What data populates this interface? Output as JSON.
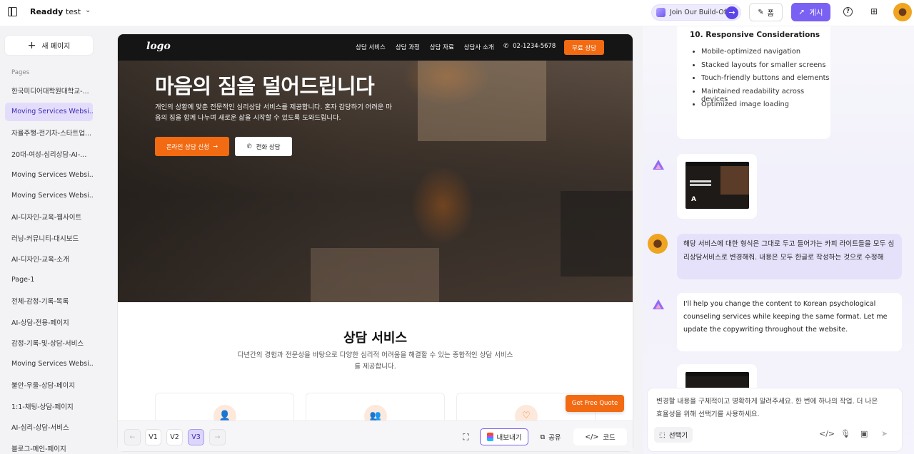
{
  "topbar": {
    "brand": "Readdy",
    "project": "test",
    "buildoff_label": "Join Our Build-Off",
    "form_label": "폼",
    "publish_label": "게시"
  },
  "sidebar": {
    "new_page_label": "새 페이지",
    "pages_heading": "Pages",
    "pages": [
      "한국미디어대학원대학교-...",
      "Moving Services Websi...",
      "자율주행-전기차-스타트업...",
      "20대-여성-심리상담-AI-...",
      "Moving Services Websi...",
      "Moving Services Websi...",
      "AI-디자인-교육-웹사이트",
      "러닝-커뮤니티-대시보드",
      "AI-디자인-교육-소개",
      "Page-1",
      "전체-감정-기록-목록",
      "AI-상담-전용-페이지",
      "감정-기록-및-상담-서비스",
      "Moving Services Websi...",
      "불안-우울-상담-페이지",
      "1:1-채팅-상담-페이지",
      "AI-심리-상담-서비스",
      "블로그-메인-페이지"
    ]
  },
  "preview": {
    "logo": "logo",
    "nav_links": [
      "상담 서비스",
      "상담 과정",
      "상담 자료",
      "상담사 소개"
    ],
    "phone": "02-1234-5678",
    "nav_cta": "무료 상담",
    "hero_title": "마음의 짐을 덜어드립니다",
    "hero_sub": "개인의 상황에 맞춘 전문적인 심리상담 서비스를 제공합니다. 혼자 감당하기 어려운 마음의 짐을 함께 나누며 새로운 삶을 시작할 수 있도록 도와드립니다.",
    "hero_btn_primary": "온라인 상담 신청",
    "hero_btn_secondary": "전화 상담",
    "services_title": "상담 서비스",
    "services_sub": "다년간의 경험과 전문성을 바탕으로 다양한 심리적 어려움을 해결할 수 있는 종합적인 상담 서비스를 제공합니다.",
    "quote_btn": "Get Free Quote"
  },
  "preview_toolbar": {
    "versions": [
      "V1",
      "V2",
      "V3"
    ],
    "active_version": "V3",
    "export_label": "내보내기",
    "share_label": "공유",
    "code_label": "코드"
  },
  "chat": {
    "doc_heading": "10. Responsive Considerations",
    "doc_items": [
      "Mobile-optimized navigation",
      "Stacked layouts for smaller screens",
      "Touch-friendly buttons and elements",
      "Maintained readability across devices",
      "Optimized image loading"
    ],
    "user_message": "해당 서비스에 대한 형식은 그대로 두고 들어가는 카피 라이트들을 모두 심리상담서비스로 변경해줘. 내용은 모두 한글로 작성하는 것으로 수정해",
    "bot_reply": "I'll help you change the content to Korean psychological counseling services while keeping the same format. Let me update the copywriting throughout the website.",
    "composer_placeholder": "변경할 내용을 구체적이고 명확하게 알려주세요. 한 번에 하나의 작업. 더 나은 효율성을 위해 선택기를 사용하세요.",
    "selector_label": "선택기"
  }
}
